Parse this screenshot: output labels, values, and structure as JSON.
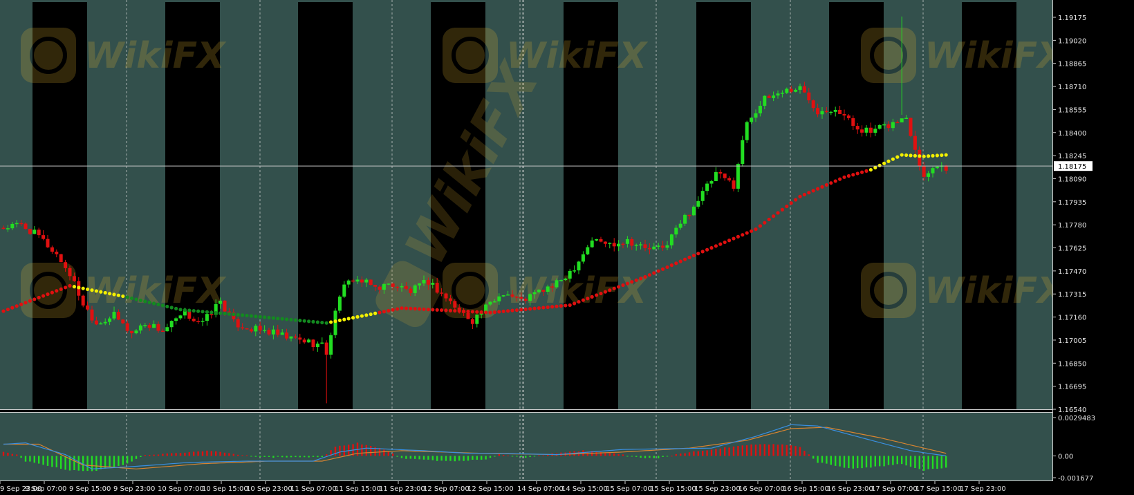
{
  "watermark": {
    "text": "WikiFX",
    "color": "#e0b030"
  },
  "colors": {
    "background_band": "#33504c",
    "session_band": "#000000",
    "bull": "#22dd22",
    "bear": "#e01010",
    "ma_red": "#e01010",
    "ma_yellow": "#f4f000",
    "ma_green": "#138a20",
    "macd_line": "#3a8fe0",
    "signal_line": "#d98530",
    "axis_text": "#e8e8e8"
  },
  "price_axis": {
    "ticks": [
      "1.19175",
      "1.19020",
      "1.18865",
      "1.18710",
      "1.18555",
      "1.18400",
      "1.18245",
      "1.18090",
      "1.17935",
      "1.17780",
      "1.17625",
      "1.17470",
      "1.17315",
      "1.17160",
      "1.17005",
      "1.16850",
      "1.16695",
      "1.16540"
    ],
    "current_price": "1.18175",
    "ylim": [
      1.1654,
      1.19175
    ]
  },
  "macd_axis": {
    "ticks": [
      "0.0029483",
      "0.00",
      "-0.001677"
    ],
    "ylim": [
      -0.001677,
      0.0029483
    ]
  },
  "time_axis": {
    "labels": [
      "9 Sep 23:00",
      "9 Sep 07:00",
      "9 Sep 15:00",
      "9 Sep 23:00",
      "10 Sep 07:00",
      "10 Sep 15:00",
      "10 Sep 23:00",
      "11 Sep 07:00",
      "11 Sep 15:00",
      "11 Sep 23:00",
      "12 Sep 07:00",
      "12 Sep 15:00",
      "14 Sep 07:00",
      "14 Sep 15:00",
      "15 Sep 07:00",
      "15 Sep 15:00",
      "15 Sep 23:00",
      "16 Sep 07:00",
      "16 Sep 15:00",
      "16 Sep 23:00",
      "17 Sep 07:00",
      "17 Sep 15:00",
      "17 Sep 23:00"
    ]
  },
  "chart_data": [
    {
      "type": "candlestick",
      "x_unit": "bar index (hourly)",
      "ylim": [
        1.1654,
        1.19175
      ],
      "close_anchors": [
        [
          0,
          1.1776
        ],
        [
          4,
          1.1778
        ],
        [
          8,
          1.177
        ],
        [
          12,
          1.1758
        ],
        [
          15,
          1.1745
        ],
        [
          18,
          1.1725
        ],
        [
          21,
          1.1712
        ],
        [
          25,
          1.1717
        ],
        [
          29,
          1.1705
        ],
        [
          32,
          1.1712
        ],
        [
          36,
          1.1707
        ],
        [
          41,
          1.1718
        ],
        [
          45,
          1.1712
        ],
        [
          49,
          1.1727
        ],
        [
          52,
          1.1712
        ],
        [
          56,
          1.1708
        ],
        [
          60,
          1.1706
        ],
        [
          64,
          1.1702
        ],
        [
          68,
          1.17
        ],
        [
          72,
          1.1697
        ],
        [
          73,
          1.1692
        ],
        [
          76,
          1.1732
        ],
        [
          79,
          1.1742
        ],
        [
          84,
          1.1736
        ],
        [
          88,
          1.1738
        ],
        [
          92,
          1.1733
        ],
        [
          96,
          1.174
        ],
        [
          100,
          1.1729
        ],
        [
          103,
          1.172
        ],
        [
          106,
          1.1714
        ],
        [
          109,
          1.1722
        ],
        [
          113,
          1.1733
        ],
        [
          117,
          1.1727
        ],
        [
          121,
          1.1733
        ],
        [
          125,
          1.1738
        ],
        [
          129,
          1.175
        ],
        [
          133,
          1.1768
        ],
        [
          137,
          1.1765
        ],
        [
          141,
          1.1768
        ],
        [
          145,
          1.1762
        ],
        [
          149,
          1.1762
        ],
        [
          153,
          1.1779
        ],
        [
          157,
          1.1795
        ],
        [
          161,
          1.1812
        ],
        [
          165,
          1.1805
        ],
        [
          168,
          1.1848
        ],
        [
          172,
          1.1862
        ],
        [
          176,
          1.1868
        ],
        [
          180,
          1.187
        ],
        [
          184,
          1.1855
        ],
        [
          188,
          1.1857
        ],
        [
          192,
          1.1845
        ],
        [
          196,
          1.184
        ],
        [
          200,
          1.1845
        ],
        [
          204,
          1.185
        ],
        [
          206,
          1.183
        ],
        [
          208,
          1.181
        ],
        [
          210,
          1.1818
        ],
        [
          213,
          1.1817
        ]
      ],
      "special_bars": [
        {
          "x": 73,
          "low": 1.1658
        },
        {
          "x": 203,
          "high": 1.1918,
          "low": 1.1852
        }
      ]
    },
    {
      "type": "line",
      "name_visible": false,
      "points": [
        [
          0,
          1.172
        ],
        [
          15,
          1.1737
        ],
        [
          27,
          1.173
        ],
        [
          40,
          1.1721
        ],
        [
          55,
          1.1717
        ],
        [
          73,
          1.1712
        ],
        [
          90,
          1.1722
        ],
        [
          110,
          1.1719
        ],
        [
          128,
          1.1724
        ],
        [
          145,
          1.1743
        ],
        [
          158,
          1.176
        ],
        [
          170,
          1.1775
        ],
        [
          180,
          1.1797
        ],
        [
          190,
          1.181
        ],
        [
          196,
          1.1815
        ],
        [
          203,
          1.1825
        ],
        [
          208,
          1.1824
        ],
        [
          213,
          1.1825
        ]
      ],
      "color_segments": [
        {
          "from": 0,
          "to": 15,
          "color": "red"
        },
        {
          "from": 15,
          "to": 27,
          "color": "yellow"
        },
        {
          "from": 27,
          "to": 73,
          "color": "green"
        },
        {
          "from": 73,
          "to": 84,
          "color": "yellow"
        },
        {
          "from": 84,
          "to": 195,
          "color": "red"
        },
        {
          "from": 195,
          "to": 213,
          "color": "yellow"
        }
      ]
    },
    {
      "type": "bar+line",
      "name_visible": false,
      "ylim": [
        -0.001677,
        0.0029483
      ],
      "histogram_anchors": [
        [
          0,
          0.0003
        ],
        [
          3,
          0.0001
        ],
        [
          5,
          -0.0004
        ],
        [
          15,
          -0.0011
        ],
        [
          20,
          -0.0012
        ],
        [
          28,
          -0.0006
        ],
        [
          32,
          0.0001
        ],
        [
          40,
          0.0002
        ],
        [
          47,
          0.0004
        ],
        [
          53,
          0.0001
        ],
        [
          58,
          -0.0001
        ],
        [
          65,
          -0.0001
        ],
        [
          72,
          -0.0001
        ],
        [
          75,
          0.0007
        ],
        [
          80,
          0.001
        ],
        [
          86,
          0.0005
        ],
        [
          90,
          -0.0002
        ],
        [
          100,
          -0.0004
        ],
        [
          109,
          -0.0003
        ],
        [
          112,
          0.0001
        ],
        [
          118,
          -0.0001
        ],
        [
          125,
          0.0002
        ],
        [
          131,
          0.0004
        ],
        [
          138,
          0.0002
        ],
        [
          143,
          -0.0001
        ],
        [
          148,
          -0.0002
        ],
        [
          153,
          0.0002
        ],
        [
          160,
          0.0005
        ],
        [
          170,
          0.0009
        ],
        [
          176,
          0.0009
        ],
        [
          180,
          0.0007
        ],
        [
          184,
          -0.0005
        ],
        [
          192,
          -0.001
        ],
        [
          198,
          -0.0008
        ],
        [
          203,
          -0.0006
        ],
        [
          208,
          -0.0011
        ],
        [
          213,
          -0.0009
        ]
      ],
      "macd_anchors": [
        [
          0,
          0.0009
        ],
        [
          5,
          0.001
        ],
        [
          14,
          0.0001
        ],
        [
          20,
          -0.001
        ],
        [
          30,
          -0.0008
        ],
        [
          42,
          -0.0005
        ],
        [
          55,
          -0.0004
        ],
        [
          70,
          -0.0004
        ],
        [
          76,
          0.0003
        ],
        [
          82,
          0.0006
        ],
        [
          95,
          0.0004
        ],
        [
          105,
          0.0002
        ],
        [
          112,
          0.0002
        ],
        [
          125,
          0.0001
        ],
        [
          140,
          0.0005
        ],
        [
          160,
          0.0006
        ],
        [
          170,
          0.0015
        ],
        [
          178,
          0.0024
        ],
        [
          184,
          0.0023
        ],
        [
          195,
          0.0013
        ],
        [
          205,
          0.0004
        ],
        [
          213,
          0.0
        ]
      ],
      "signal_anchors": [
        [
          0,
          0.0009
        ],
        [
          8,
          0.0009
        ],
        [
          18,
          -0.0007
        ],
        [
          30,
          -0.001
        ],
        [
          45,
          -0.0006
        ],
        [
          60,
          -0.0004
        ],
        [
          72,
          -0.0004
        ],
        [
          80,
          0.0002
        ],
        [
          90,
          0.0004
        ],
        [
          108,
          0.0002
        ],
        [
          125,
          0.0001
        ],
        [
          140,
          0.0003
        ],
        [
          155,
          0.0006
        ],
        [
          168,
          0.0012
        ],
        [
          178,
          0.0021
        ],
        [
          186,
          0.0022
        ],
        [
          198,
          0.0014
        ],
        [
          213,
          0.0002
        ]
      ]
    }
  ]
}
